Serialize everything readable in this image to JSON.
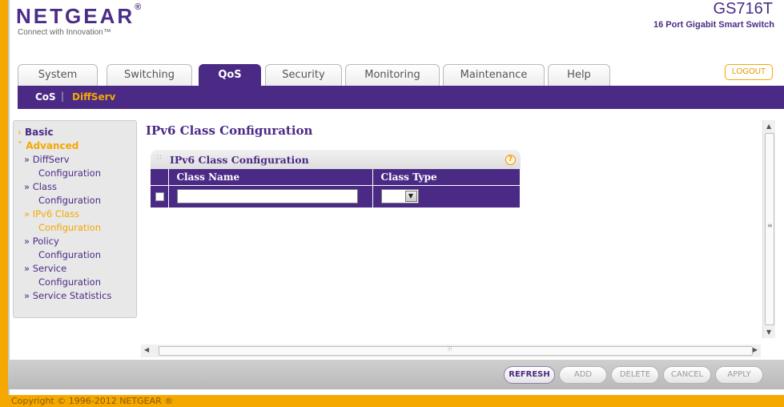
{
  "header": {
    "logo": "NETGEAR",
    "logo_mark": "®",
    "tagline": "Connect with Innovation™",
    "model": "GS716T",
    "model_desc": "16 Port Gigabit Smart Switch",
    "logout_label": "LOGOUT"
  },
  "tabs": [
    {
      "label": "System",
      "active": false
    },
    {
      "label": "Switching",
      "active": false
    },
    {
      "label": "QoS",
      "active": true
    },
    {
      "label": "Security",
      "active": false
    },
    {
      "label": "Monitoring",
      "active": false
    },
    {
      "label": "Maintenance",
      "active": false
    },
    {
      "label": "Help",
      "active": false
    }
  ],
  "subnav": {
    "items": [
      "CoS",
      "DiffServ"
    ],
    "separator": "|",
    "active": "DiffServ"
  },
  "leftmenu": {
    "basic": "Basic",
    "advanced": "Advanced",
    "items": [
      {
        "line1": "» DiffServ",
        "line2": "Configuration"
      },
      {
        "line1": "» Class",
        "line2": "Configuration"
      },
      {
        "line1": "» IPv6 Class",
        "line2": "Configuration"
      },
      {
        "line1": "» Policy",
        "line2": "Configuration"
      },
      {
        "line1": "» Service",
        "line2": "Configuration"
      },
      {
        "line1": "» Service Statistics",
        "line2": ""
      }
    ],
    "active_index": 2
  },
  "main": {
    "page_title": "IPv6 Class Configuration",
    "panel_title": "IPv6 Class Configuration",
    "columns": [
      "Class Name",
      "Class Type"
    ],
    "row": {
      "class_name": "",
      "class_type": ""
    }
  },
  "buttons": [
    "REFRESH",
    "ADD",
    "DELETE",
    "CANCEL",
    "APPLY"
  ],
  "footer": {
    "copyright": "Copyright © 1996-2012 NETGEAR ®"
  },
  "colors": {
    "brand_purple": "#4b2a86",
    "accent_orange": "#f5a800"
  },
  "icons": {
    "help": "help-icon",
    "dropdown": "chevron-down-icon"
  }
}
